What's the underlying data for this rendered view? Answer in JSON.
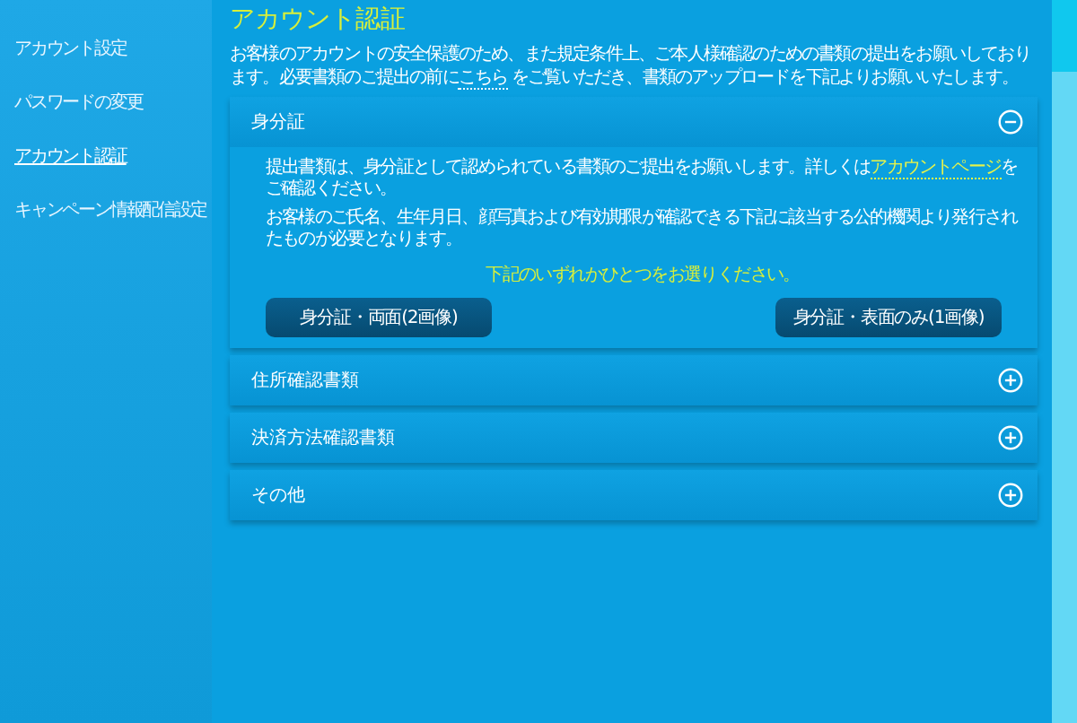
{
  "sidebar": {
    "items": [
      {
        "label": "アカウント設定",
        "selected": false
      },
      {
        "label": "パスワードの変更",
        "selected": false
      },
      {
        "label": "アカウント認証",
        "selected": true
      },
      {
        "label": "キャンペーン情報配信設定",
        "selected": false
      }
    ]
  },
  "page": {
    "title": "アカウント認証",
    "intro": {
      "before": "お客様のアカウントの安全保護のため、また規定条件上、ご本人様確認のための書類の提出をお願いしております。必要書類のご提出の前に",
      "link": "こちら",
      "after": " をご覧いただき、書類のアップロードを下記よりお願いいたします。"
    }
  },
  "sections": [
    {
      "title": "身分証",
      "expanded": true,
      "body": {
        "line1": {
          "before": "提出書類は、身分証として認められている書類のご提出をお願いします。詳しくは",
          "link": "アカウントページ",
          "after": "をご確認ください。"
        },
        "line2": "お客様のご氏名、生年月日、顔写真および有効期限が確認できる下記に該当する公的機関より発行されたものが必要となります。",
        "prompt": "下記のいずれかひとつをお選りください。",
        "buttons": [
          "身分証・両面(2画像)",
          "身分証・表面のみ(1画像)"
        ]
      }
    },
    {
      "title": "住所確認書類",
      "expanded": false
    },
    {
      "title": "決済方法確認書類",
      "expanded": false
    },
    {
      "title": "その他",
      "expanded": false
    }
  ]
}
